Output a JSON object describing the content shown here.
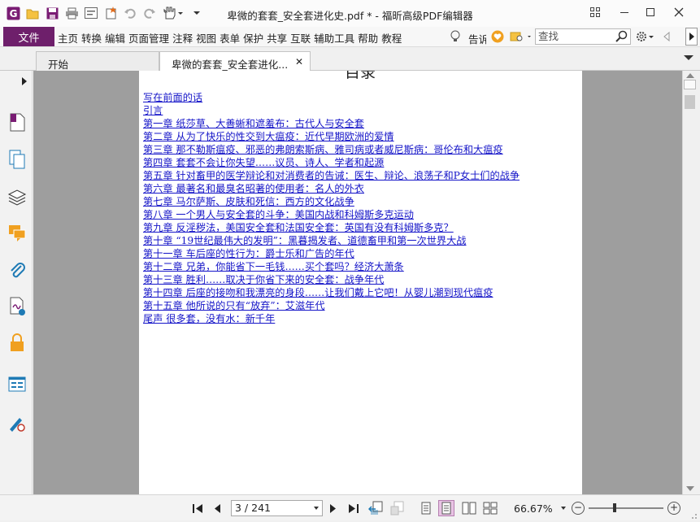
{
  "window": {
    "title": "卑微的套套_安全套进化史.pdf * - 福昕高级PDF编辑器"
  },
  "menubar": {
    "file_label": "文件",
    "items": [
      "主页",
      "转换",
      "编辑",
      "页面管理",
      "注释",
      "视图",
      "表单",
      "保护",
      "共享",
      "互联",
      "辅助工具",
      "帮助",
      "教程"
    ],
    "tell_label": "告诉",
    "search_placeholder": "查找"
  },
  "tabs": [
    {
      "label": "开始"
    },
    {
      "label": "卑微的套套_安全套进化..."
    }
  ],
  "document": {
    "heading": "目录",
    "toc": [
      "写在前面的话",
      "引言",
      "第一章 纸莎草、大善蜥和遮羞布：古代人与安全套",
      "第二章 从为了快乐的性交到大瘟疫：近代早期欧洲的爱情",
      "第三章 那不勒斯瘟疫、邪恶的弗朗索斯病、雅司病或者威尼斯病：哥伦布和大瘟疫",
      "第四章 套套不会让你失望……议员、诗人、学者和起源",
      "第五章 针对畜甲的医学辩论和对消费者的告诫：医生、辩论、浪荡子和P女士们的战争",
      "第六章 最著名和最臭名昭著的使用者：名人的外衣",
      "第七章 马尔萨斯、皮肤和死信：西方的文化战争",
      "第八章 一个男人与安全套的斗争：美国内战和科姆斯多克运动",
      "第九章 反淫秽法，美国安全套和法国安全套：英国有没有科姆斯多克？",
      "第十章 “19世纪最伟大的发明”：黑暮揭发者、道德畜甲和第一次世界大战",
      "第十一章 车后座的性行为：爵士乐和广告的年代",
      "第十二章 兄弟，你能省下一毛钱……买个套吗？经济大萧条",
      "第十三章 胜利……取决于你省下来的安全套：战争年代",
      "第十四章 后座的接吻和我漂亮的身段……让我们戴上它吧！从婴儿潮到现代瘟疫",
      "第十五章 他所说的只有“放弃”：艾滋年代",
      "尾声 很多套，没有水：新千年"
    ]
  },
  "statusbar": {
    "page_value": "3 / 241",
    "zoom_value": "66.67%"
  },
  "colors": {
    "accent": "#6e1f6b",
    "link": "#1414c8",
    "canvas_bg": "#9e9e9e"
  },
  "icons": {
    "app": "foxit-logo-icon",
    "open": "folder-open-icon",
    "save": "save-icon",
    "print": "print-icon",
    "properties": "properties-icon",
    "new": "new-document-icon",
    "undo": "undo-icon",
    "redo": "redo-icon",
    "hand": "hand-tool-icon"
  }
}
